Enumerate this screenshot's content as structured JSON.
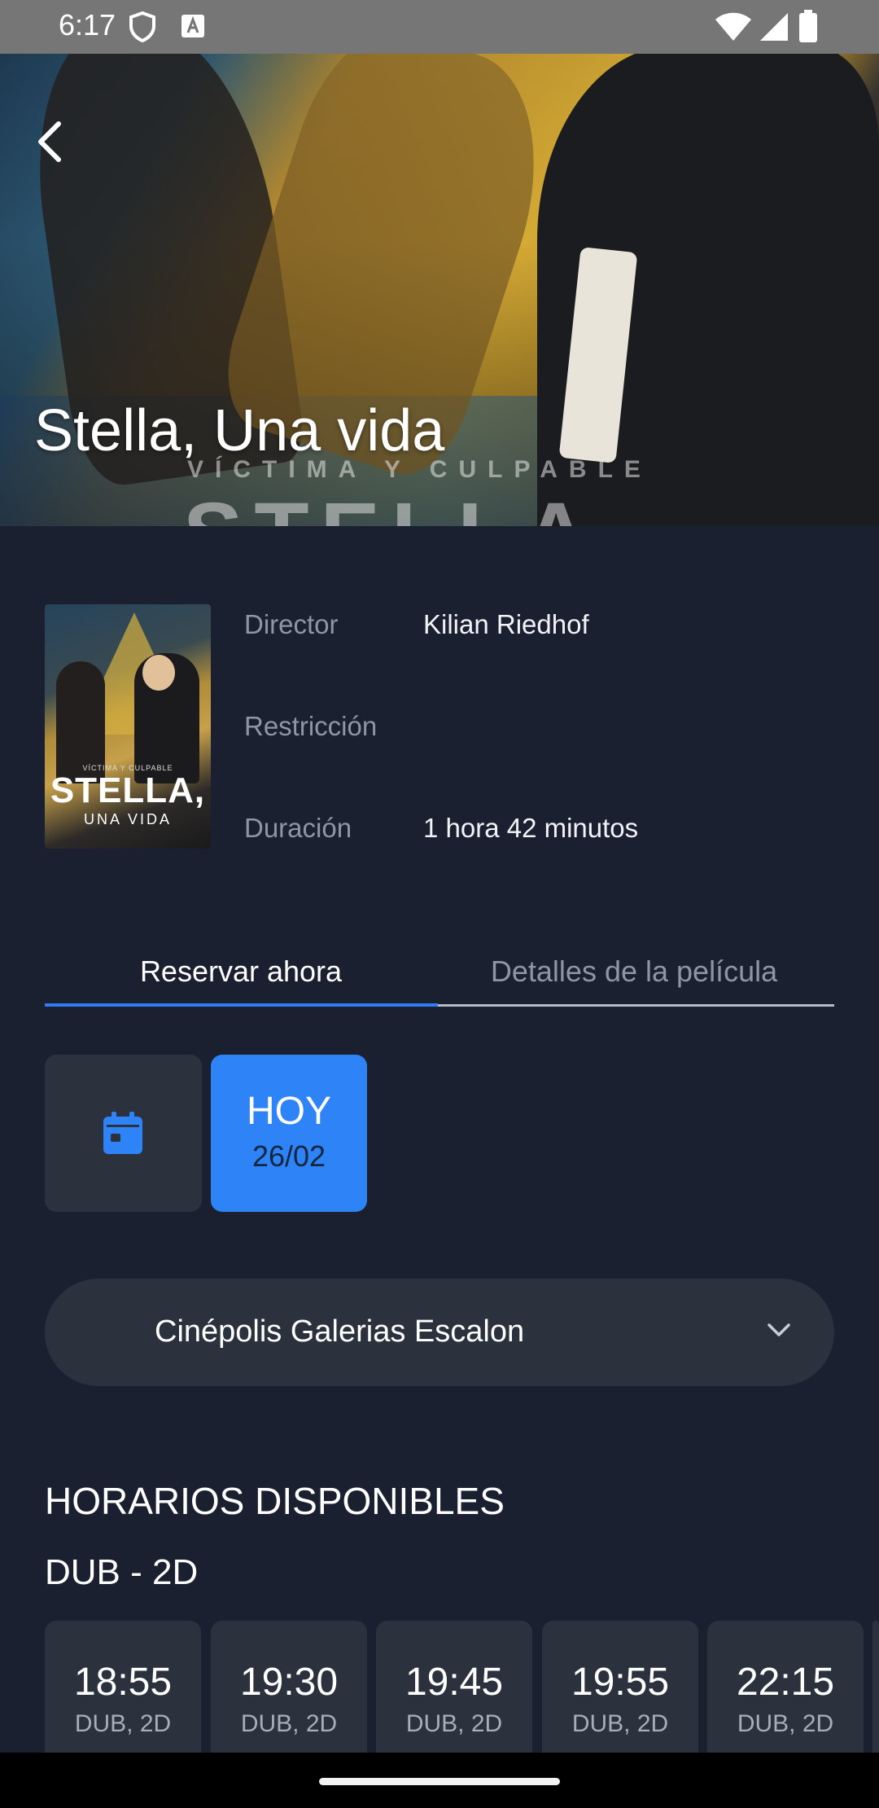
{
  "status_bar": {
    "time": "6:17",
    "icons": [
      "shield-icon",
      "font-a-icon",
      "wifi-icon",
      "signal-icon",
      "battery-icon"
    ]
  },
  "hero": {
    "title": "Stella, Una vida",
    "tagline": "VÍCTIMA Y CULPABLE",
    "big_text": "STELLA",
    "back_icon": "chevron-left-icon"
  },
  "poster": {
    "tagline": "VÍCTIMA Y CULPABLE",
    "title": "STELLA,",
    "subtitle": "UNA VIDA"
  },
  "info": {
    "director_label": "Director",
    "director_value": "Kilian Riedhof",
    "restriction_label": "Restricción",
    "restriction_value": "",
    "duration_label": "Duración",
    "duration_value": "1 hora 42 minutos"
  },
  "tabs": [
    {
      "label": "Reservar ahora",
      "active": true
    },
    {
      "label": "Detalles de la película",
      "active": false
    }
  ],
  "date_picker": {
    "calendar_icon": "calendar-icon",
    "today_label": "HOY",
    "today_date": "26/02"
  },
  "cinema": {
    "selected": "Cinépolis Galerias Escalon",
    "dropdown_icon": "chevron-down-icon"
  },
  "schedule": {
    "section_title": "HORARIOS DISPONIBLES",
    "format_title": "DUB - 2D",
    "showtimes": [
      {
        "time": "18:55",
        "format": "DUB, 2D"
      },
      {
        "time": "19:30",
        "format": "DUB, 2D"
      },
      {
        "time": "19:45",
        "format": "DUB, 2D"
      },
      {
        "time": "19:55",
        "format": "DUB, 2D"
      },
      {
        "time": "22:15",
        "format": "DUB, 2D"
      }
    ]
  },
  "colors": {
    "background": "#1a2030",
    "accent": "#2e84f6",
    "card": "#2b313d",
    "muted_text": "#8e96a6"
  }
}
